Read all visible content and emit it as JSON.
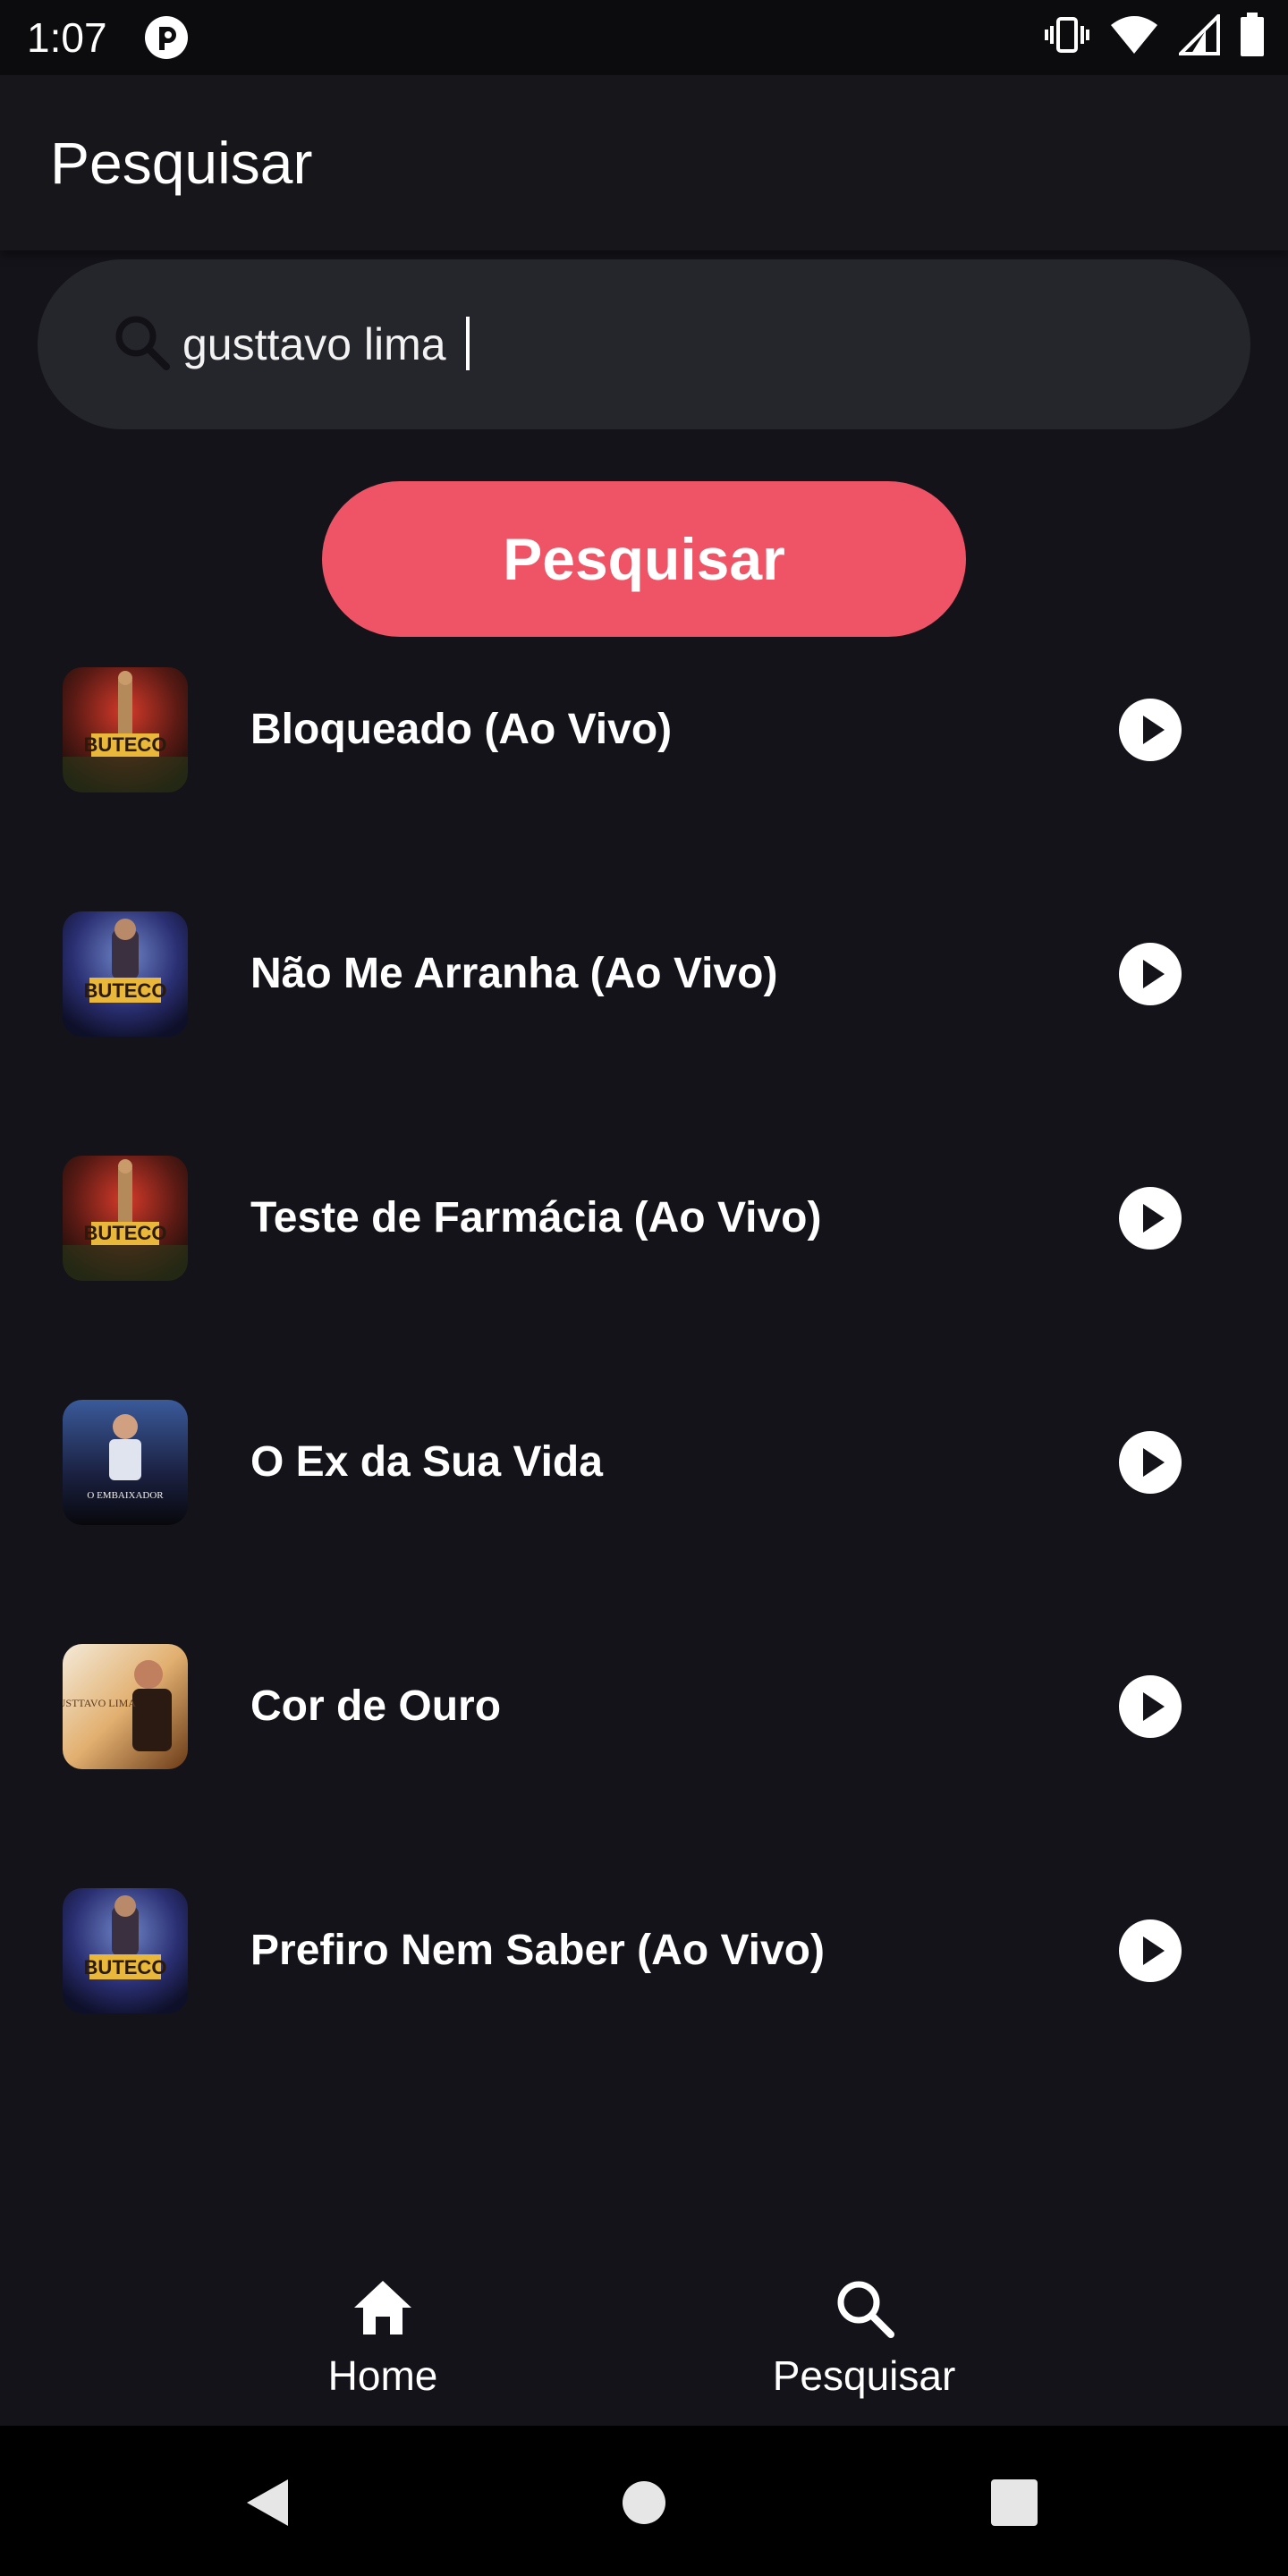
{
  "status_bar": {
    "time": "1:07",
    "icons": [
      "app-notification-icon",
      "vibrate-icon",
      "wifi-icon",
      "signal-icon",
      "battery-icon"
    ]
  },
  "app_bar": {
    "title": "Pesquisar"
  },
  "search": {
    "value": "gusttavo lima",
    "icon": "search-icon"
  },
  "search_button": {
    "label": "Pesquisar",
    "color": "#ee5466"
  },
  "results": [
    {
      "title": "Bloqueado (Ao Vivo)",
      "thumb_text": "BUTECO"
    },
    {
      "title": "Não Me Arranha (Ao Vivo)",
      "thumb_text": "BUTECO"
    },
    {
      "title": "Teste de Farmácia (Ao Vivo)",
      "thumb_text": "BUTECO"
    },
    {
      "title": "O Ex da Sua Vida",
      "thumb_text": "O EMBAIXADOR"
    },
    {
      "title": "Cor de Ouro",
      "thumb_text": "GUSTTAVO LIMA"
    },
    {
      "title": "Prefiro Nem Saber (Ao Vivo)",
      "thumb_text": "BUTECO"
    }
  ],
  "bottom_nav": {
    "items": [
      {
        "label": "Home",
        "icon": "home-icon"
      },
      {
        "label": "Pesquisar",
        "icon": "search-icon"
      }
    ]
  },
  "system_nav": {
    "icons": [
      "back-icon",
      "home-circle-icon",
      "recents-icon"
    ]
  },
  "colors": {
    "background": "#131319",
    "accent": "#ee5466",
    "search_field": "#25252c"
  }
}
